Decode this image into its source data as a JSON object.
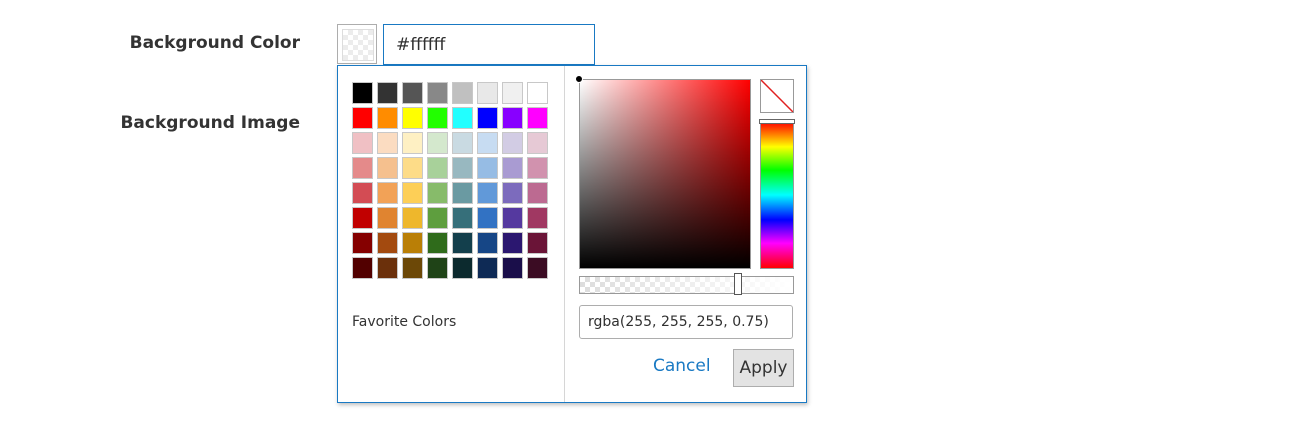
{
  "fields": {
    "background_color_label": "Background Color",
    "background_image_label": "Background Image",
    "hex_value": "#ffffff"
  },
  "picker": {
    "palette_rows": [
      [
        "#000000",
        "#333333",
        "#555555",
        "#888888",
        "#c0c0c0",
        "#e8e8e8",
        "#f0f0f0",
        "#ffffff"
      ],
      [
        "#ff0000",
        "#ff8c00",
        "#ffff00",
        "#22ff00",
        "#22ffff",
        "#0000ff",
        "#8800ff",
        "#ff00ff"
      ],
      [
        "#f0c0c4",
        "#fbdcc1",
        "#fef0c3",
        "#d4e8cd",
        "#c9dae2",
        "#c7dcf2",
        "#d2cce4",
        "#e6c9d5"
      ],
      [
        "#e48a8a",
        "#f5c08e",
        "#fddc88",
        "#a8d19a",
        "#98b8c0",
        "#96bce4",
        "#a99bd2",
        "#d192ae"
      ],
      [
        "#d34c54",
        "#f2a257",
        "#fdcf57",
        "#87bb6a",
        "#6a9aa2",
        "#6199d9",
        "#7c6bbd",
        "#bc6a91"
      ],
      [
        "#c10000",
        "#e08430",
        "#eeb72c",
        "#5e9e3e",
        "#366f7a",
        "#3272c3",
        "#55399f",
        "#a03862"
      ],
      [
        "#850000",
        "#a34a0f",
        "#ba7f06",
        "#2f6b1b",
        "#133f4c",
        "#164686",
        "#2b1770",
        "#6a1437"
      ],
      [
        "#520000",
        "#6b300b",
        "#6c4807",
        "#1f4317",
        "#0c2a2e",
        "#0e2a55",
        "#1a0e4a",
        "#3b0c23"
      ]
    ],
    "favorite_colors_label": "Favorite Colors",
    "hue_color": "#ff0000",
    "alpha_level": 0.75,
    "rgba_value": "rgba(255, 255, 255, 0.75)",
    "cancel_label": "Cancel",
    "apply_label": "Apply",
    "accent_color": "#1979c3"
  }
}
